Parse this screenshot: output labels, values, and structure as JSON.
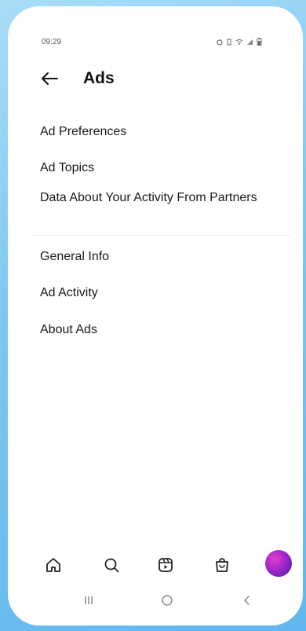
{
  "status_bar": {
    "time": "09:29",
    "icons": [
      "alarm-icon",
      "vibrate-icon",
      "wifi-icon",
      "signal-icon",
      "battery-icon"
    ]
  },
  "header": {
    "title": "Ads",
    "back_icon": "arrow-left-icon"
  },
  "menu": {
    "section_1": [
      {
        "label": "Ad Preferences"
      },
      {
        "label": "Ad Topics"
      },
      {
        "label": "Data About Your Activity From Partners"
      }
    ],
    "section_2": [
      {
        "label": "General Info"
      },
      {
        "label": "Ad Activity"
      },
      {
        "label": "About Ads"
      }
    ]
  },
  "bottom_nav": {
    "items": [
      "home-icon",
      "search-icon",
      "reels-icon",
      "shop-icon",
      "profile-avatar"
    ]
  },
  "system_nav": {
    "items": [
      "recents-icon",
      "home-circle-icon",
      "back-chevron-icon"
    ]
  },
  "colors": {
    "background": "#7cc6f2",
    "text": "#1a1a1a",
    "avatar_start": "#e040c8",
    "avatar_end": "#3b1aa8"
  }
}
